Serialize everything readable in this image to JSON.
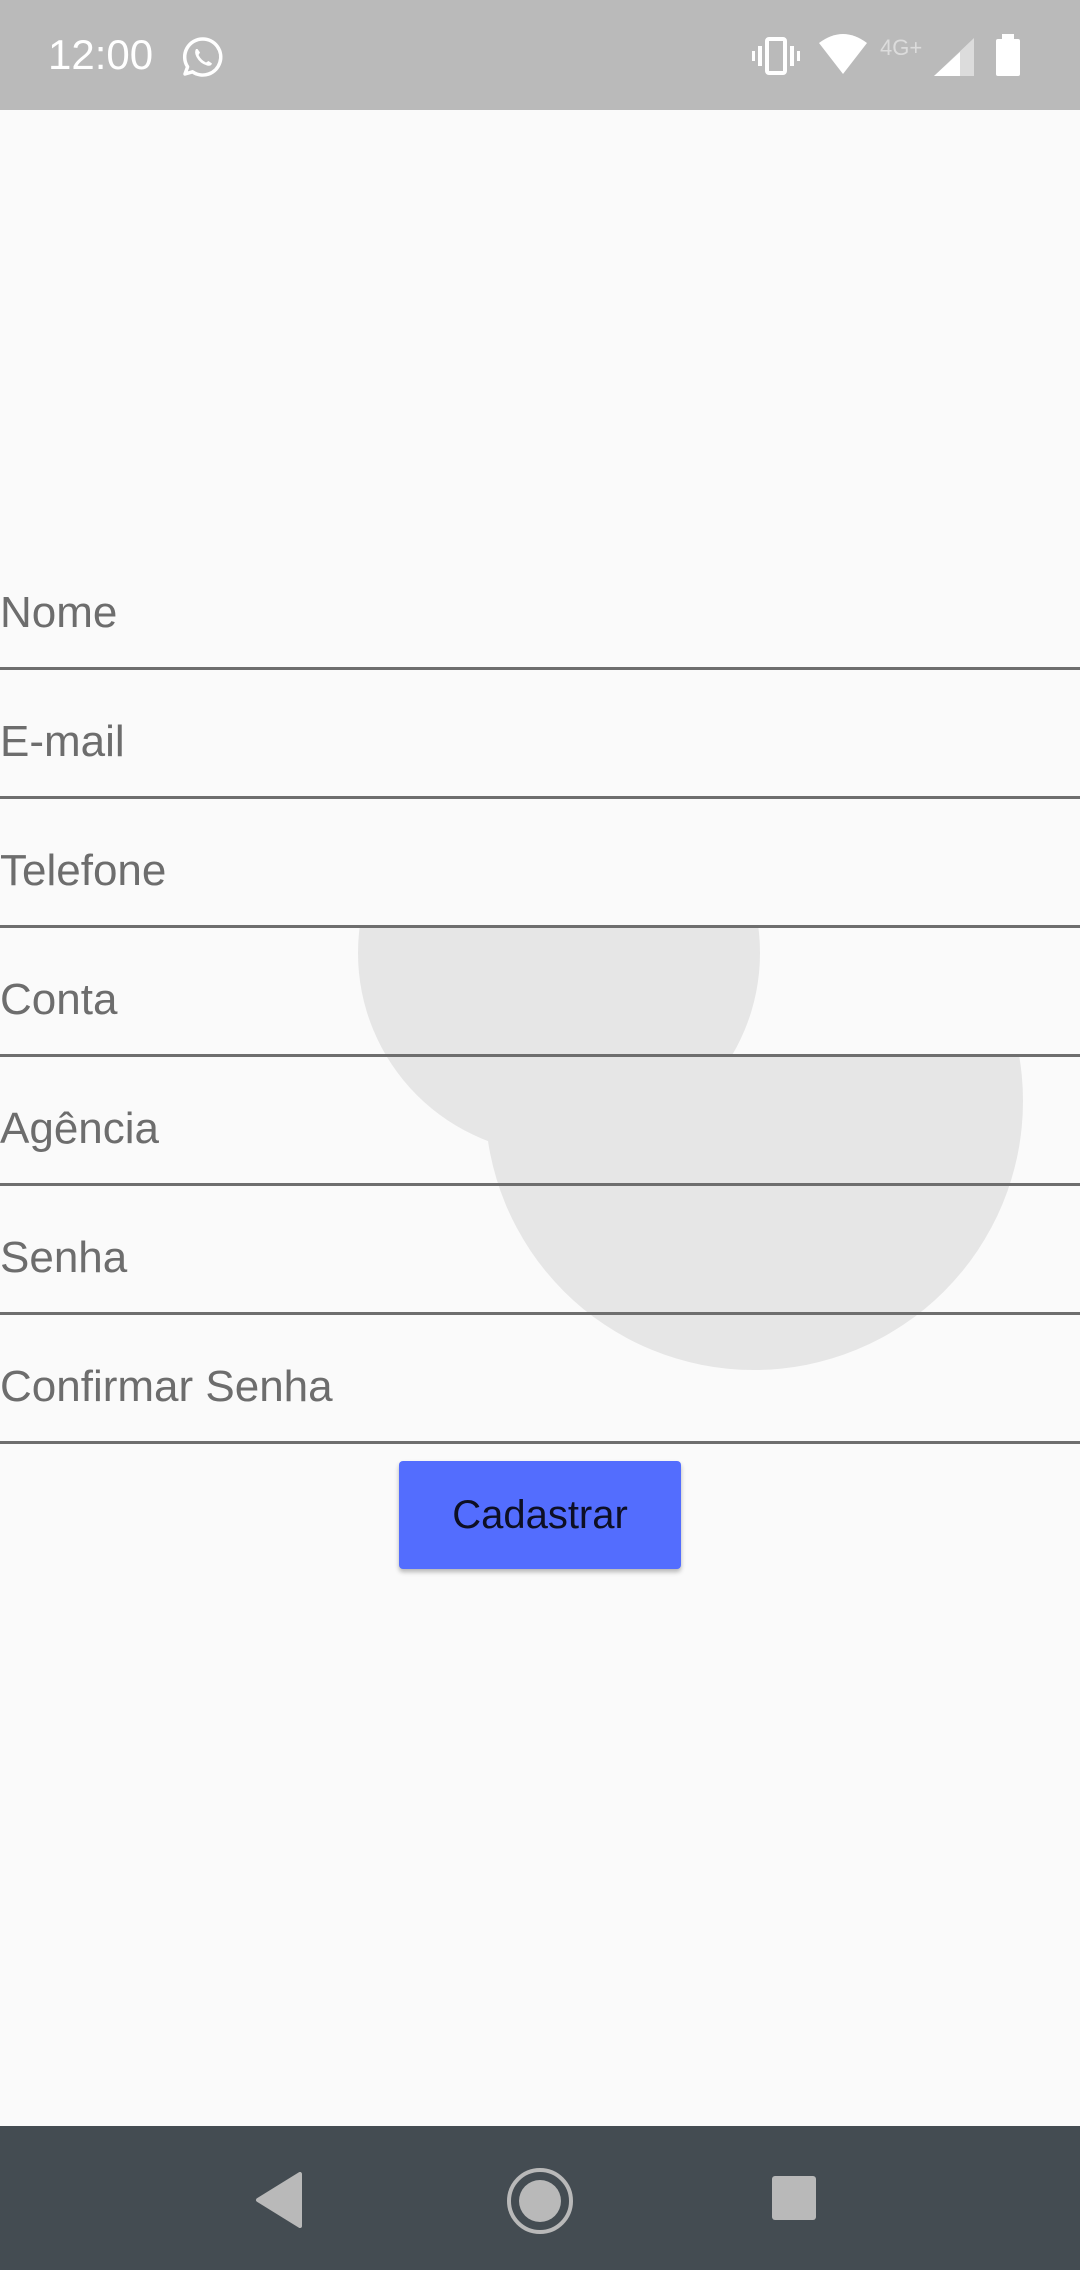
{
  "status_bar": {
    "time": "12:00",
    "network_type": "4G+",
    "icons": [
      "whatsapp-icon",
      "vibrate-icon",
      "wifi-icon",
      "signal-icon",
      "battery-icon"
    ]
  },
  "form": {
    "fields": [
      {
        "name": "nome",
        "placeholder": "Nome",
        "value": ""
      },
      {
        "name": "email",
        "placeholder": "E-mail",
        "value": ""
      },
      {
        "name": "telefone",
        "placeholder": "Telefone",
        "value": ""
      },
      {
        "name": "conta",
        "placeholder": "Conta",
        "value": ""
      },
      {
        "name": "agencia",
        "placeholder": "Agência",
        "value": ""
      },
      {
        "name": "senha",
        "placeholder": "Senha",
        "value": ""
      },
      {
        "name": "confirmar-senha",
        "placeholder": "Confirmar Senha",
        "value": ""
      }
    ],
    "submit_label": "Cadastrar"
  },
  "nav_bar": {
    "buttons": [
      "back-icon",
      "home-icon",
      "recents-icon"
    ]
  },
  "colors": {
    "status_bar": "#bababa",
    "background": "#fafafa",
    "accent": "#536dfe",
    "nav_bar": "#444c52",
    "field_underline": "#6e6e6e",
    "placeholder": "#6d6d6d"
  }
}
